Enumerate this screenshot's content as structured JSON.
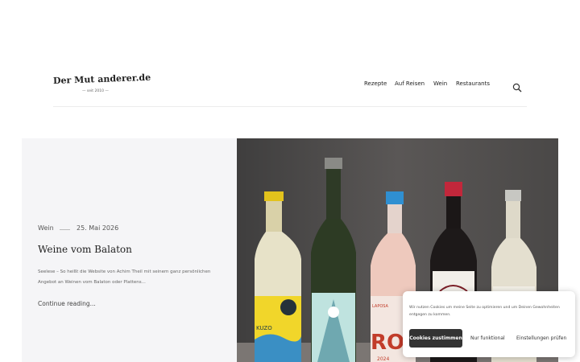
{
  "site": {
    "logo_title": "Der Mut anderer.de",
    "logo_tagline": "— seit 2010 —"
  },
  "nav": {
    "items": [
      {
        "label": "Rezepte"
      },
      {
        "label": "Auf Reisen"
      },
      {
        "label": "Wein"
      },
      {
        "label": "Restaurants"
      }
    ],
    "search_icon": "search-icon"
  },
  "post": {
    "category": "Wein",
    "date": "25. Mai 2026",
    "title": "Weine vom Balaton",
    "excerpt": "Seelese – So heißt die Website von Achim Theil mit seinem ganz persönlichen Angebot an Weinen vom Balaton oder Plattens...",
    "read_more": "Continue reading...",
    "image_labels": {
      "bottle1": "KUZO",
      "bottle4": "LAPOSA",
      "bottle4_big": "ROS",
      "bottle4_year": "2024"
    }
  },
  "cookie": {
    "text": "Wir nutzen Cookies um meine Seite zu optimieren und um Deinen Gewohnheiten entgegen zu kommen.",
    "accept": "Cookies zustimmen",
    "functional": "Nur funktional",
    "settings": "Einstellungen prüfen"
  },
  "colors": {
    "accent_dark": "#333333",
    "panel_bg": "#f5f5f7",
    "photo_bg": "#4d4b4a"
  }
}
